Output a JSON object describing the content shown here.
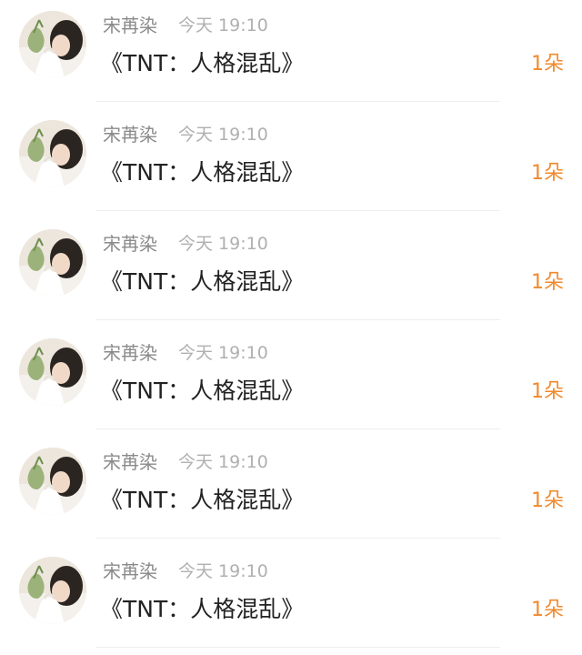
{
  "colors": {
    "name": "#8a8a8a",
    "time": "#b0b0b0",
    "message": "#222222",
    "count": "#f08a2e"
  },
  "rows": [
    {
      "avatar": "user-avatar-photo",
      "name": "宋苒染",
      "time": "今天 19:10",
      "message": "《TNT：人格混乱》",
      "count": "1朵"
    },
    {
      "avatar": "user-avatar-photo",
      "name": "宋苒染",
      "time": "今天 19:10",
      "message": "《TNT：人格混乱》",
      "count": "1朵"
    },
    {
      "avatar": "user-avatar-photo",
      "name": "宋苒染",
      "time": "今天 19:10",
      "message": "《TNT：人格混乱》",
      "count": "1朵"
    },
    {
      "avatar": "user-avatar-photo",
      "name": "宋苒染",
      "time": "今天 19:10",
      "message": "《TNT：人格混乱》",
      "count": "1朵"
    },
    {
      "avatar": "user-avatar-photo",
      "name": "宋苒染",
      "time": "今天 19:10",
      "message": "《TNT：人格混乱》",
      "count": "1朵"
    },
    {
      "avatar": "user-avatar-photo",
      "name": "宋苒染",
      "time": "今天 19:10",
      "message": "《TNT：人格混乱》",
      "count": "1朵"
    }
  ]
}
